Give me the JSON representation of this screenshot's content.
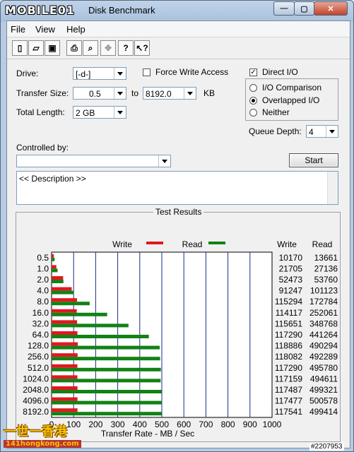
{
  "window": {
    "logo_text": "MOBILE01",
    "title": "Disk Benchmark",
    "controls": {
      "minimize": "—",
      "maximize": "▢",
      "close": "✕"
    }
  },
  "menu": [
    "File",
    "View",
    "Help"
  ],
  "toolbar_icons": [
    "new-file-icon",
    "open-folder-icon",
    "save-icon",
    "print-icon",
    "print-preview-icon",
    "move-icon",
    "help-icon",
    "context-help-icon"
  ],
  "form": {
    "drive_label": "Drive:",
    "drive_value": "[-d-]",
    "force_write_label": "Force Write Access",
    "direct_io_label": "Direct I/O",
    "transfer_size_label": "Transfer Size:",
    "transfer_from": "0.5",
    "to_label": "to",
    "transfer_to": "8192.0",
    "kb_label": "KB",
    "total_length_label": "Total Length:",
    "total_length_value": "2 GB",
    "io_comparison_label": "I/O Comparison",
    "overlapped_io_label": "Overlapped I/O",
    "neither_label": "Neither",
    "queue_depth_label": "Queue Depth:",
    "queue_depth_value": "4",
    "controlled_by_label": "Controlled by:",
    "controlled_by_value": "",
    "start_label": "Start",
    "description": "<< Description >>"
  },
  "results": {
    "group_title": "Test Results",
    "write_legend": "Write",
    "read_legend": "Read",
    "write_header": "Write",
    "read_header": "Read",
    "xlabel": "Transfer Rate - MB / Sec",
    "write_color": "#e0191e",
    "read_color": "#128214"
  },
  "chart_data": {
    "type": "bar",
    "categories": [
      "0.5",
      "1.0",
      "2.0",
      "4.0",
      "8.0",
      "16.0",
      "32.0",
      "64.0",
      "128.0",
      "256.0",
      "512.0",
      "1024.0",
      "2048.0",
      "4096.0",
      "8192.0"
    ],
    "series": [
      {
        "name": "Write",
        "values": [
          10170,
          21705,
          52473,
          91247,
          115294,
          114117,
          115651,
          117290,
          118886,
          118082,
          117290,
          117159,
          117487,
          117477,
          117541
        ]
      },
      {
        "name": "Read",
        "values": [
          13661,
          27136,
          53760,
          101123,
          172784,
          252061,
          348768,
          441264,
          490294,
          492289,
          495780,
          494611,
          499321,
          500578,
          499414
        ]
      }
    ],
    "xticks": [
      "0",
      "100",
      "200",
      "300",
      "400",
      "500",
      "600",
      "700",
      "800",
      "900",
      "1000"
    ],
    "xlabel": "Transfer Rate - MB / Sec",
    "xlim": [
      0,
      1000
    ]
  },
  "watermark": {
    "line1": "一世一香港",
    "line2": "141hongkong.com",
    "badge": "#2207953"
  }
}
